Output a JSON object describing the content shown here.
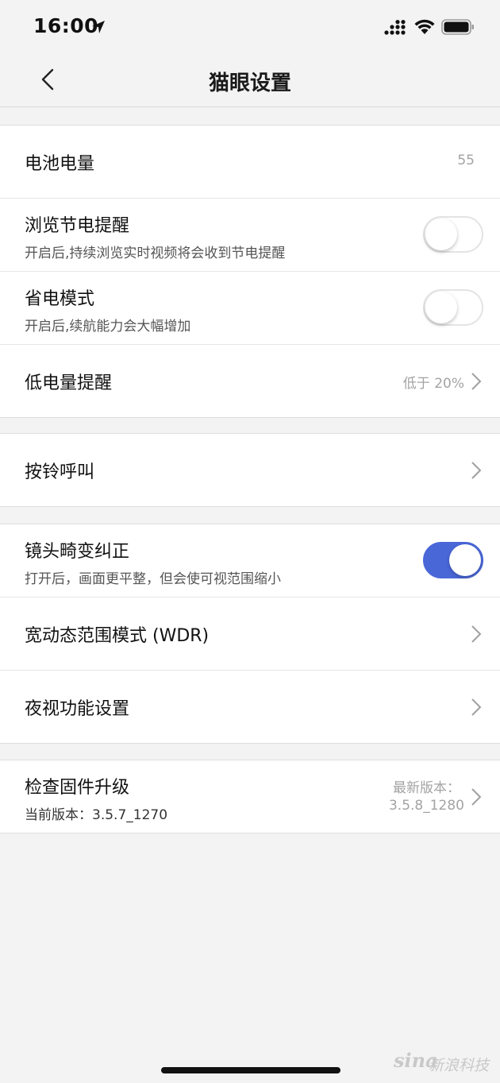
{
  "status_bar": {
    "time": "16:00",
    "icons": [
      "location-arrow-icon",
      "cellular-signal-icon",
      "wifi-icon",
      "battery-icon"
    ]
  },
  "nav": {
    "title": "猫眼设置",
    "back_icon": "chevron-left-icon"
  },
  "colors": {
    "accent": "#4a67d8",
    "background": "#f3f3f3",
    "secondary_text": "#a3a3a3"
  },
  "battery_group": {
    "battery_level": {
      "label": "电池电量",
      "value": "55"
    },
    "browse_saving_reminder": {
      "label": "浏览节电提醒",
      "description": "开启后,持续浏览实时视频将会收到节电提醒",
      "enabled": false
    },
    "power_saving_mode": {
      "label": "省电模式",
      "description": "开启后,续航能力会大幅增加",
      "enabled": false
    },
    "low_battery_alert": {
      "label": "低电量提醒",
      "value": "低于 20%"
    }
  },
  "doorbell_group": {
    "ring_call": {
      "label": "按铃呼叫"
    }
  },
  "camera_group": {
    "lens_distortion": {
      "label": "镜头畸变纠正",
      "description": "打开后，画面更平整，但会使可视范围缩小",
      "enabled": true
    },
    "wdr": {
      "label": "宽动态范围模式 (WDR)"
    },
    "night_vision": {
      "label": "夜视功能设置"
    }
  },
  "firmware_group": {
    "check_update": {
      "label": "检查固件升级",
      "current_version": "当前版本：3.5.7_1270",
      "latest_label": "最新版本：",
      "latest_version": "3.5.8_1280"
    }
  },
  "watermark": {
    "logo": "sina",
    "text": "新浪科技"
  }
}
